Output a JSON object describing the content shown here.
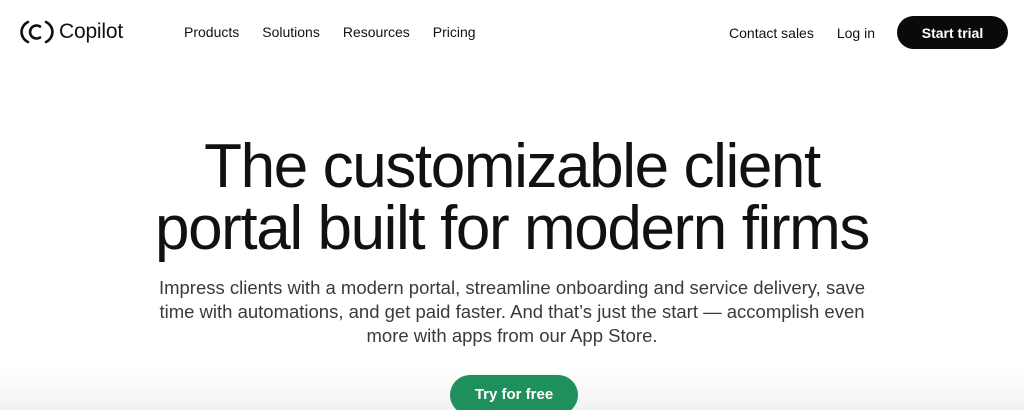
{
  "brand": {
    "name": "Copilot",
    "logo_icon": "copilot-bracket-logo"
  },
  "nav": {
    "items": [
      {
        "label": "Products"
      },
      {
        "label": "Solutions"
      },
      {
        "label": "Resources"
      },
      {
        "label": "Pricing"
      }
    ]
  },
  "header_actions": {
    "contact_label": "Contact sales",
    "login_label": "Log in",
    "start_trial_label": "Start trial"
  },
  "hero": {
    "title_line1": "The customizable client",
    "title_line2": "portal built for modern firms",
    "subtitle": "Impress clients with a modern portal, streamline onboarding and service delivery, save time with automations, and get paid faster. And that’s just the start — accomplish even more with apps from our App Store.",
    "cta_label": "Try for free"
  },
  "colors": {
    "cta_green": "#1f8f5c",
    "primary_black": "#0a0a0a",
    "text": "#111111",
    "subtitle_text": "#3a3a3a"
  }
}
